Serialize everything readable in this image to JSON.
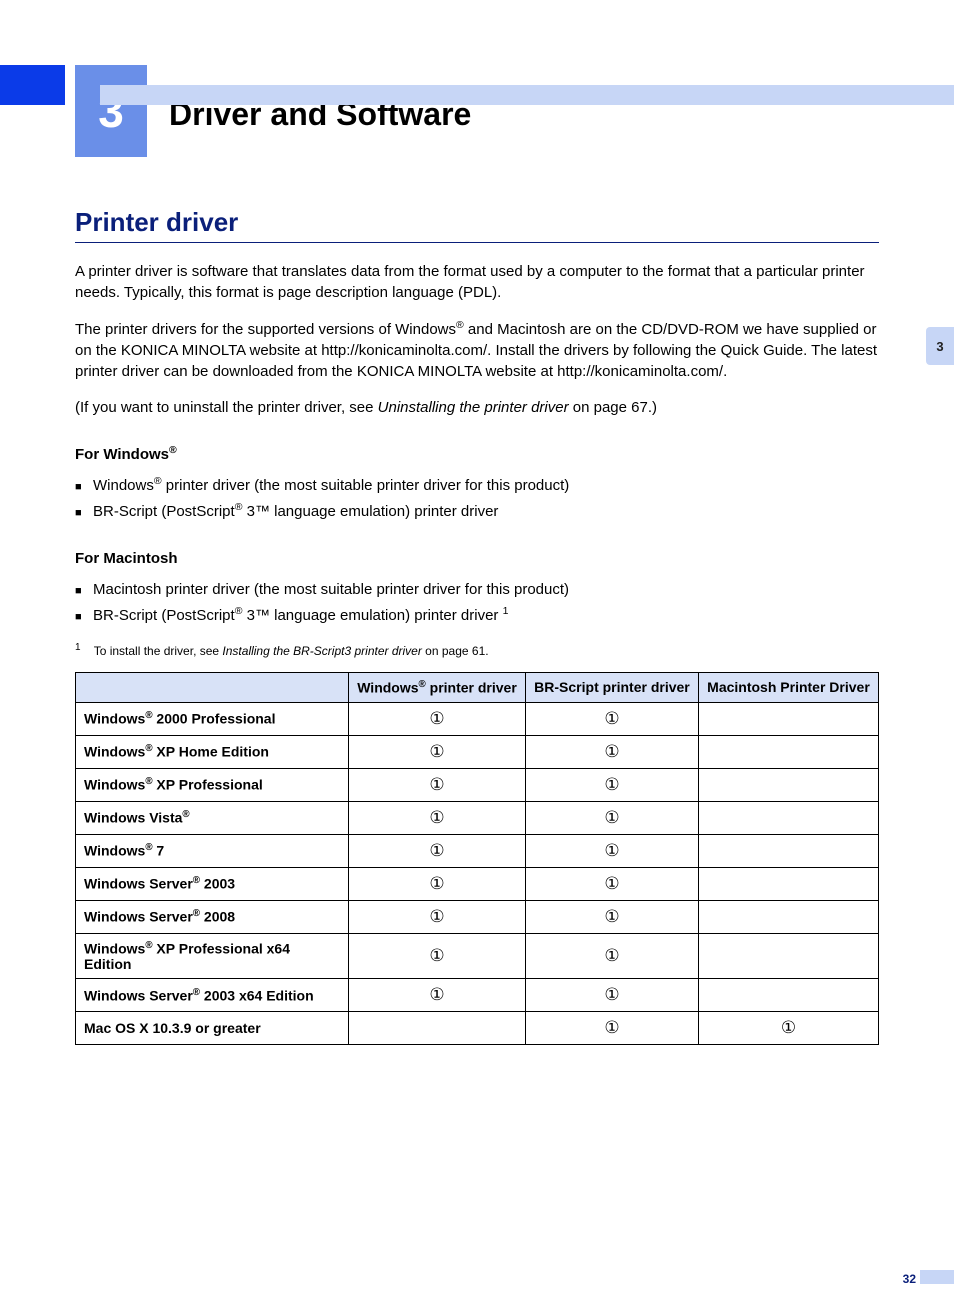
{
  "chapter": {
    "number": "3",
    "title": "Driver and Software",
    "tab": "3",
    "page": "32"
  },
  "section": {
    "title": "Printer driver"
  },
  "paragraphs": {
    "p1": "A printer driver is software that translates data from the format used by a computer to the format that a particular printer needs. Typically, this format is page description language (PDL).",
    "p2_pre": "The printer drivers for the supported versions of Windows",
    "p2_post": " and Macintosh are on the CD/DVD-ROM we have supplied or on the KONICA MINOLTA website at http://konicaminolta.com/. Install the drivers by following the Quick Guide. The latest printer driver can be downloaded from the KONICA MINOLTA website at http://konicaminolta.com/.",
    "p3_pre": "(If you want to uninstall the printer driver, see ",
    "p3_link": "Uninstalling the printer driver",
    "p3_post": " on page 67.)"
  },
  "windows": {
    "heading_pre": "For Windows",
    "b1_pre": "Windows",
    "b1_post": " printer driver (the most suitable printer driver for this product)",
    "b2_pre": "BR-Script (PostScript",
    "b2_mid": " 3™ language emulation) printer driver"
  },
  "mac": {
    "heading": "For Macintosh",
    "b1": "Macintosh printer driver (the most suitable printer driver for this product)",
    "b2_pre": "BR-Script (PostScript",
    "b2_mid": " 3™ language emulation) printer driver ",
    "b2_ref": "1"
  },
  "footnote": {
    "num": "1",
    "text_pre": "To install the driver, see ",
    "text_link": "Installing the BR-Script3 printer driver",
    "text_post": " on page 61."
  },
  "table": {
    "h1_pre": "Windows",
    "h1_post": " printer driver",
    "h2": "BR-Script printer driver",
    "h3": "Macintosh Printer Driver",
    "rows": [
      {
        "os_pre": "Windows",
        "os_sup": "®",
        "os_post": " 2000 Professional",
        "c1": "①",
        "c2": "①",
        "c3": ""
      },
      {
        "os_pre": "Windows",
        "os_sup": "®",
        "os_post": " XP Home Edition",
        "c1": "①",
        "c2": "①",
        "c3": ""
      },
      {
        "os_pre": "Windows",
        "os_sup": "®",
        "os_post": " XP Professional",
        "c1": "①",
        "c2": "①",
        "c3": ""
      },
      {
        "os_pre": "Windows Vista",
        "os_sup": "®",
        "os_post": "",
        "c1": "①",
        "c2": "①",
        "c3": ""
      },
      {
        "os_pre": "Windows",
        "os_sup": "®",
        "os_post": " 7",
        "c1": "①",
        "c2": "①",
        "c3": ""
      },
      {
        "os_pre": "Windows Server",
        "os_sup": "®",
        "os_post": " 2003",
        "c1": "①",
        "c2": "①",
        "c3": ""
      },
      {
        "os_pre": "Windows Server",
        "os_sup": "®",
        "os_post": " 2008",
        "c1": "①",
        "c2": "①",
        "c3": ""
      },
      {
        "os_pre": "Windows",
        "os_sup": "®",
        "os_post": " XP Professional x64 Edition",
        "c1": "①",
        "c2": "①",
        "c3": ""
      },
      {
        "os_pre": "Windows Server",
        "os_sup": "®",
        "os_post": " 2003 x64 Edition",
        "c1": "①",
        "c2": "①",
        "c3": ""
      },
      {
        "os_pre": "Mac OS X 10.3.9 or greater",
        "os_sup": "",
        "os_post": "",
        "c1": "",
        "c2": "①",
        "c3": "①"
      }
    ]
  }
}
